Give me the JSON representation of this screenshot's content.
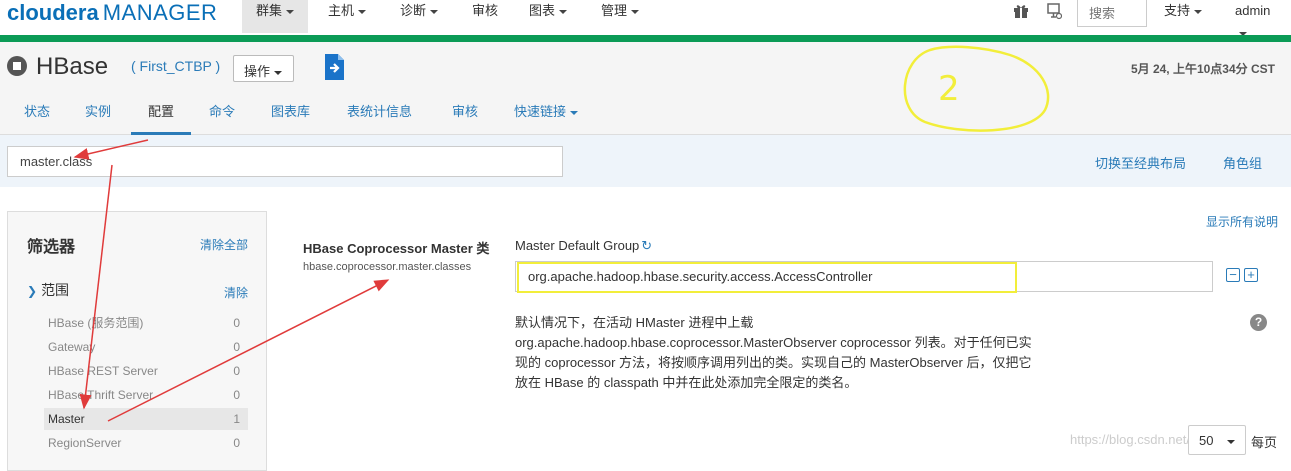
{
  "app": {
    "logo_brand": "cloudera",
    "logo_product": "MANAGER"
  },
  "nav": {
    "items": [
      {
        "label": "群集",
        "has_caret": true,
        "active": true
      },
      {
        "label": "主机",
        "has_caret": true
      },
      {
        "label": "诊断",
        "has_caret": true
      },
      {
        "label": "审核",
        "has_caret": false
      },
      {
        "label": "图表",
        "has_caret": true
      },
      {
        "label": "管理",
        "has_caret": true
      }
    ],
    "search_placeholder": "搜索",
    "support_label": "支持",
    "user_label": "admin"
  },
  "service": {
    "name": "HBase",
    "cluster": "( First_CTBP )",
    "actions_label": "操作",
    "timestamp": "5月 24, 上午10点34分 CST"
  },
  "tabs": [
    {
      "label": "状态"
    },
    {
      "label": "实例"
    },
    {
      "label": "配置",
      "active": true
    },
    {
      "label": "命令"
    },
    {
      "label": "图表库"
    },
    {
      "label": "表统计信息"
    },
    {
      "label": "审核"
    },
    {
      "label": "快速链接",
      "has_caret": true
    }
  ],
  "filterbar": {
    "search_value": "master.class",
    "classic_layout_link": "切换至经典布局",
    "role_groups_link": "角色组"
  },
  "filters": {
    "title": "筛选器",
    "clear_all": "清除全部",
    "scope_title": "范围",
    "scope_clear": "清除",
    "rows": [
      {
        "label": "HBase (服务范围)",
        "count": "0"
      },
      {
        "label": "Gateway",
        "count": "0"
      },
      {
        "label": "HBase REST Server",
        "count": "0"
      },
      {
        "label": "HBase Thrift Server",
        "count": "0"
      },
      {
        "label": "Master",
        "count": "1",
        "selected": true
      },
      {
        "label": "RegionServer",
        "count": "0"
      }
    ]
  },
  "config": {
    "show_all_descriptions": "显示所有说明",
    "property_title": "HBase Coprocessor Master 类",
    "property_key": "hbase.coprocessor.master.classes",
    "group_label": "Master Default Group",
    "value": "org.apache.hadoop.hbase.security.access.AccessController",
    "description_lines": [
      "默认情况下，在活动 HMaster 进程中上载",
      "org.apache.hadoop.hbase.coprocessor.MasterObserver coprocessor 列表。对于任何已实",
      "现的 coprocessor 方法，将按顺序调用列出的类。实现自己的 MasterObserver 后，仅把它",
      "放在 HBase 的 classpath 中并在此处添加完全限定的类名。"
    ]
  },
  "pagination": {
    "per_page_value": "50",
    "per_page_label": "每页"
  },
  "watermark": "https://blog.csdn.net/ja",
  "annotations": {
    "handwritten_mark": "2",
    "arrow_color": "#e03b3b",
    "highlight_color": "#f2ee3a"
  },
  "colors": {
    "brand": "#0a6fb7",
    "accent_green": "#0b9b56",
    "link": "#2a7bb8"
  }
}
